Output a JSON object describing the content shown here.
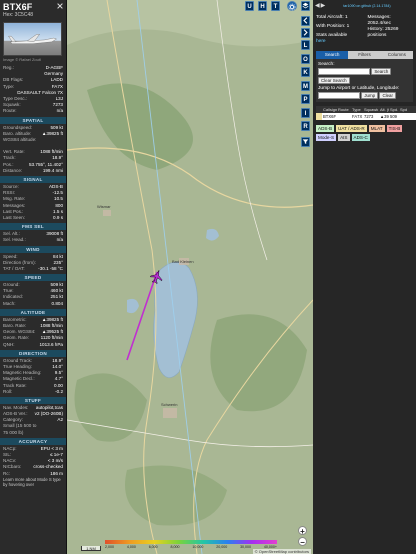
{
  "aircraft": {
    "callsign": "BTX6F",
    "hex": "Hex: 3C5C48",
    "photo_credit": "Image © Rafael Zoutl",
    "info": [
      {
        "k": "Reg.:",
        "v": "D-AGBF"
      },
      {
        "k": "",
        "v": "Germany"
      },
      {
        "k": "DB Flags:",
        "v": "LADD"
      },
      {
        "k": "Type:",
        "v": "FA7X"
      },
      {
        "k": "",
        "v": "DASSAULT Falcon 7X"
      },
      {
        "k": "Type Desc.:",
        "v": "L3J"
      },
      {
        "k": "Squawk:",
        "v": "7273"
      },
      {
        "k": "Route:",
        "v": "n/a"
      }
    ]
  },
  "sections": [
    {
      "title": "SPATIAL",
      "rows": [
        {
          "k": "Groundspeed:",
          "v": "509 kt"
        },
        {
          "k": "Baro. altitude:",
          "v": "▲39825 ft"
        },
        {
          "k": "WGS84 altitude:",
          "v": ""
        },
        {
          "k": "",
          "v": ""
        },
        {
          "k": "Vert. Rate:",
          "v": "1088 ft/min"
        },
        {
          "k": "Track:",
          "v": "18.9°"
        },
        {
          "k": "Pos.:",
          "v": "53.755°, 11.402°"
        },
        {
          "k": "Distance:",
          "v": "199.4 nmi"
        }
      ]
    },
    {
      "title": "SIGNAL",
      "rows": [
        {
          "k": "Source:",
          "v": "ADS-B"
        },
        {
          "k": "RSSI:",
          "v": "-12.5"
        },
        {
          "k": "Msg. Rate:",
          "v": "10.5"
        },
        {
          "k": "Messages:",
          "v": "800"
        },
        {
          "k": "Last Pos.:",
          "v": "1.5 s"
        },
        {
          "k": "Last Seen:",
          "v": "0.9 s"
        }
      ]
    },
    {
      "title": "FMS SEL",
      "rows": [
        {
          "k": "Sel. Alt.:",
          "v": "39008 ft"
        },
        {
          "k": "Sel. Head.:",
          "v": "n/a"
        }
      ]
    },
    {
      "title": "WIND",
      "rows": [
        {
          "k": "Speed:",
          "v": "84 kt"
        },
        {
          "k": "Direction (from):",
          "v": "235°"
        },
        {
          "k": "TAT / OAT:",
          "v": "-30.1 -58 °C"
        }
      ]
    },
    {
      "title": "SPEED",
      "rows": [
        {
          "k": "Ground:",
          "v": "509 kt"
        },
        {
          "k": "True:",
          "v": "460 kt"
        },
        {
          "k": "Indicated:",
          "v": "251 kt"
        },
        {
          "k": "Mach:",
          "v": "0.804"
        }
      ]
    },
    {
      "title": "ALTITUDE",
      "rows": [
        {
          "k": "Barometric:",
          "v": "▲39825 ft"
        },
        {
          "k": "Baro. Rate:",
          "v": "1088 ft/min"
        },
        {
          "k": "Geom. WGS84:",
          "v": "▲39525 ft"
        },
        {
          "k": "Geom. Rate:",
          "v": "1120 ft/min"
        },
        {
          "k": "QNH:",
          "v": "1013.6 hPa"
        }
      ]
    },
    {
      "title": "DIRECTION",
      "rows": [
        {
          "k": "Ground Track:",
          "v": "18.9°"
        },
        {
          "k": "True Heading:",
          "v": "14.0°"
        },
        {
          "k": "Magnetic Heading:",
          "v": "9.5°"
        },
        {
          "k": "Magnetic Decl.:",
          "v": "4.7°"
        },
        {
          "k": "Track Rate:",
          "v": "0.00"
        },
        {
          "k": "Roll:",
          "v": "-0.2"
        }
      ]
    },
    {
      "title": "STUFF",
      "rows": [
        {
          "k": "Nav. Modes:",
          "v": "autopilot,tcas"
        },
        {
          "k": "ADS-B Ver.:",
          "v": "v2 (DO-260B)"
        },
        {
          "k": "Category:",
          "v": "A2"
        },
        {
          "k": "Small (15 500 to",
          "v": ""
        },
        {
          "k": "75 000 lb)",
          "v": ""
        }
      ]
    },
    {
      "title": "ACCURACY",
      "rows": [
        {
          "k": "NACp:",
          "v": "EPU < 3 m"
        },
        {
          "k": "SIL:",
          "v": "≤ 1e-7"
        },
        {
          "k": "NACv:",
          "v": "< 3 m/s"
        },
        {
          "k": "NICbaro:",
          "v": "cross-checked"
        },
        {
          "k": "Rc:",
          "v": "186 m"
        }
      ]
    }
  ],
  "footer_note": "Learn more about Mode S type by hovering over",
  "map": {
    "top_buttons": [
      "U",
      "H",
      "T"
    ],
    "side_buttons": [
      "L",
      "O",
      "K",
      "M",
      "P",
      "I",
      "R"
    ],
    "scale_label": "1 NM",
    "legend_ticks": [
      "2,000",
      "4,000",
      "6,000",
      "8,000",
      "10,000",
      "20,000",
      "30,000",
      "40,000+"
    ],
    "attribution": "© OpenStreetMap contributors",
    "place_labels": [
      "Bad Kleinen",
      "Schwerin",
      "Wismar"
    ]
  },
  "right": {
    "version": "tar1090 on github (2.14.1784)",
    "stats": {
      "total": "Total Aircraft: 1",
      "with_pos": "With Position: 1",
      "stats_avail": "Stats available",
      "stats_link": "here",
      "messages_label": "Messages:",
      "messages_val": "2052.4/sec",
      "history_label": "History: 25269",
      "history_val": "positions"
    },
    "tabs": [
      "Search",
      "Filters",
      "Columns"
    ],
    "search_label": "Search:",
    "search_button": "Search",
    "clear_button": "Clear Search",
    "jump_label": "Jump to Airport or Latitude, Longitude:",
    "jump_button": "Jump",
    "clear_small": "Clear",
    "table_headers": [
      "",
      "Callsign",
      "Route",
      "Type",
      "Squawk",
      "Alt. (ft)",
      "Spd. (kt)",
      "Spd"
    ],
    "table_row": [
      "",
      "BTX6F",
      "",
      "FA7X",
      "7273",
      "▲39825",
      "509",
      ""
    ],
    "badges": [
      {
        "label": "ADS-B",
        "color": "#c6f0c6"
      },
      {
        "label": "UAT / ADS-R",
        "color": "#f0e0a0"
      },
      {
        "label": "MLAT",
        "color": "#f0c0a0"
      },
      {
        "label": "TIS-B",
        "color": "#f0a0a0"
      },
      {
        "label": "Mode-S",
        "color": "#d0d0ff"
      },
      {
        "label": "AIS",
        "color": "#d0d0d0"
      },
      {
        "label": "ADS-C",
        "color": "#a0e0d0"
      }
    ]
  }
}
